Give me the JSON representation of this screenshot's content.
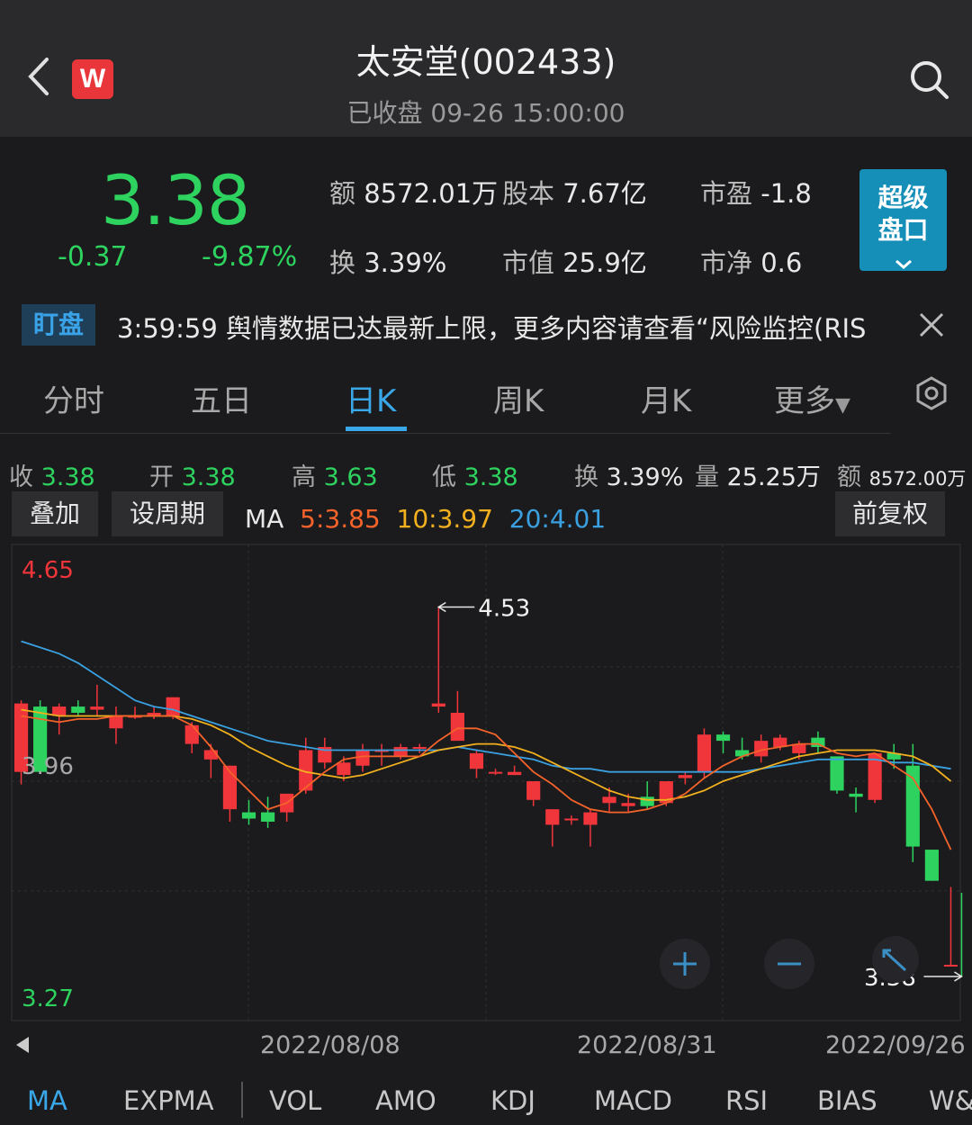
{
  "header": {
    "title": "太安堂(002433)",
    "subtitle": "已收盘 09-26 15:00:00",
    "logo_letter": "W"
  },
  "quote": {
    "price": "3.38",
    "change": "-0.37",
    "change_pct": "-9.87%",
    "amount_label": "额",
    "amount": "8572.01万",
    "share_cap_label": "股本",
    "share_cap": "7.67亿",
    "pe_label": "市盈",
    "pe": "-1.8",
    "turnover_label": "换",
    "turnover": "3.39%",
    "mkt_cap_label": "市值",
    "mkt_cap": "25.9亿",
    "pb_label": "市净",
    "pb": "0.6",
    "super_button": [
      "超级",
      "盘口"
    ],
    "color_down": "#2ed35f",
    "color_up": "#f0353b"
  },
  "ticker": {
    "badge": "盯盘",
    "text": "3:59:59 舆情数据已达最新上限，更多内容请查看“风险监控(RIS"
  },
  "tabs": [
    "分时",
    "五日",
    "日K",
    "周K",
    "月K",
    "更多"
  ],
  "active_tab": "日K",
  "stats": {
    "close_label": "收",
    "close": "3.38",
    "open_label": "开",
    "open": "3.38",
    "high_label": "高",
    "high": "3.63",
    "low_label": "低",
    "low": "3.38",
    "turnover_label": "换",
    "turnover": "3.39%",
    "volume_label": "量",
    "volume": "25.25万",
    "amount_label": "额",
    "amount": "8572.00万"
  },
  "buttons": {
    "overlay": "叠加",
    "period": "设周期",
    "adjust": "前复权"
  },
  "ma_legend": {
    "label": "MA",
    "ma5": "5:3.85",
    "ma10": "10:3.97",
    "ma20": "20:4.01",
    "color_ma5": "#f5632a",
    "color_ma10": "#f2b01e",
    "color_ma20": "#3aa0e0"
  },
  "chart_data": {
    "type": "candlestick",
    "y_axis_labels": [
      "4.65",
      "3.96",
      "3.27"
    ],
    "ylim": [
      3.27,
      4.65
    ],
    "max_marker": "4.53",
    "last_marker": "3.38",
    "x_labels": [
      "2022/08/08",
      "2022/08/31",
      "2022/09/26"
    ],
    "candles": [
      {
        "o": 4.0,
        "h": 4.23,
        "l": 3.96,
        "c": 4.22
      },
      {
        "o": 4.21,
        "h": 4.23,
        "l": 4.0,
        "c": 4.0
      },
      {
        "o": 4.18,
        "h": 4.22,
        "l": 4.12,
        "c": 4.21
      },
      {
        "o": 4.21,
        "h": 4.23,
        "l": 4.18,
        "c": 4.19
      },
      {
        "o": 4.2,
        "h": 4.28,
        "l": 4.18,
        "c": 4.21
      },
      {
        "o": 4.14,
        "h": 4.21,
        "l": 4.09,
        "c": 4.18
      },
      {
        "o": 4.18,
        "h": 4.21,
        "l": 4.17,
        "c": 4.18
      },
      {
        "o": 4.18,
        "h": 4.21,
        "l": 4.17,
        "c": 4.19
      },
      {
        "o": 4.18,
        "h": 4.24,
        "l": 4.17,
        "c": 4.24
      },
      {
        "o": 4.09,
        "h": 4.16,
        "l": 4.06,
        "c": 4.15
      },
      {
        "o": 4.04,
        "h": 4.09,
        "l": 3.98,
        "c": 4.07
      },
      {
        "o": 3.88,
        "h": 4.02,
        "l": 3.84,
        "c": 4.02
      },
      {
        "o": 3.87,
        "h": 3.91,
        "l": 3.83,
        "c": 3.85
      },
      {
        "o": 3.87,
        "h": 3.92,
        "l": 3.82,
        "c": 3.84
      },
      {
        "o": 3.87,
        "h": 3.93,
        "l": 3.84,
        "c": 3.93
      },
      {
        "o": 3.94,
        "h": 4.11,
        "l": 3.93,
        "c": 4.07
      },
      {
        "o": 4.03,
        "h": 4.11,
        "l": 4.01,
        "c": 4.08
      },
      {
        "o": 3.99,
        "h": 4.05,
        "l": 3.97,
        "c": 4.03
      },
      {
        "o": 4.02,
        "h": 4.09,
        "l": 4.0,
        "c": 4.07
      },
      {
        "o": 4.07,
        "h": 4.09,
        "l": 4.02,
        "c": 4.07
      },
      {
        "o": 4.05,
        "h": 4.09,
        "l": 4.04,
        "c": 4.08
      },
      {
        "o": 4.08,
        "h": 4.09,
        "l": 4.06,
        "c": 4.08
      },
      {
        "o": 4.21,
        "h": 4.53,
        "l": 4.19,
        "c": 4.22
      },
      {
        "o": 4.1,
        "h": 4.26,
        "l": 4.1,
        "c": 4.19
      },
      {
        "o": 4.01,
        "h": 4.07,
        "l": 3.98,
        "c": 4.06
      },
      {
        "o": 4.0,
        "h": 4.01,
        "l": 3.99,
        "c": 4.0
      },
      {
        "o": 3.99,
        "h": 4.02,
        "l": 3.99,
        "c": 4.0
      },
      {
        "o": 3.91,
        "h": 3.97,
        "l": 3.89,
        "c": 3.97
      },
      {
        "o": 3.83,
        "h": 3.88,
        "l": 3.76,
        "c": 3.88
      },
      {
        "o": 3.85,
        "h": 3.86,
        "l": 3.83,
        "c": 3.85
      },
      {
        "o": 3.83,
        "h": 3.88,
        "l": 3.76,
        "c": 3.87
      },
      {
        "o": 3.9,
        "h": 3.95,
        "l": 3.87,
        "c": 3.92
      },
      {
        "o": 3.89,
        "h": 3.93,
        "l": 3.87,
        "c": 3.9
      },
      {
        "o": 3.92,
        "h": 3.97,
        "l": 3.88,
        "c": 3.89
      },
      {
        "o": 3.9,
        "h": 3.97,
        "l": 3.89,
        "c": 3.97
      },
      {
        "o": 3.98,
        "h": 4.0,
        "l": 3.96,
        "c": 3.99
      },
      {
        "o": 4.0,
        "h": 4.14,
        "l": 3.98,
        "c": 4.12
      },
      {
        "o": 4.12,
        "h": 4.13,
        "l": 4.06,
        "c": 4.1
      },
      {
        "o": 4.07,
        "h": 4.11,
        "l": 4.04,
        "c": 4.05
      },
      {
        "o": 4.05,
        "h": 4.12,
        "l": 4.03,
        "c": 4.1
      },
      {
        "o": 4.08,
        "h": 4.12,
        "l": 4.07,
        "c": 4.11
      },
      {
        "o": 4.06,
        "h": 4.1,
        "l": 4.04,
        "c": 4.09
      },
      {
        "o": 4.11,
        "h": 4.13,
        "l": 4.06,
        "c": 4.08
      },
      {
        "o": 4.05,
        "h": 4.05,
        "l": 3.93,
        "c": 3.94
      },
      {
        "o": 3.93,
        "h": 3.95,
        "l": 3.87,
        "c": 3.92
      },
      {
        "o": 3.91,
        "h": 4.06,
        "l": 3.9,
        "c": 4.06
      },
      {
        "o": 4.06,
        "h": 4.09,
        "l": 4.01,
        "c": 4.04
      },
      {
        "o": 4.02,
        "h": 4.09,
        "l": 3.71,
        "c": 3.76
      },
      {
        "o": 3.75,
        "h": 3.75,
        "l": 3.65,
        "c": 3.65
      },
      {
        "o": 3.38,
        "h": 3.63,
        "l": 3.38,
        "c": 3.38
      }
    ],
    "ma5": [
      4.18,
      4.17,
      4.16,
      4.17,
      4.17,
      4.18,
      4.18,
      4.18,
      4.18,
      4.15,
      4.08,
      4.0,
      3.94,
      3.88,
      3.9,
      3.95,
      4.0,
      4.04,
      4.05,
      4.05,
      4.05,
      4.05,
      4.1,
      4.14,
      4.14,
      4.12,
      4.06,
      4.0,
      3.96,
      3.91,
      3.88,
      3.87,
      3.87,
      3.88,
      3.9,
      3.93,
      3.98,
      4.02,
      4.05,
      4.07,
      4.08,
      4.09,
      4.09,
      4.06,
      4.05,
      4.06,
      4.02,
      3.98,
      3.88,
      3.75
    ],
    "ma10": [
      4.2,
      4.19,
      4.18,
      4.18,
      4.18,
      4.18,
      4.18,
      4.18,
      4.18,
      4.17,
      4.15,
      4.12,
      4.08,
      4.05,
      4.02,
      4.0,
      3.99,
      3.98,
      3.99,
      4.01,
      4.03,
      4.05,
      4.07,
      4.08,
      4.09,
      4.09,
      4.08,
      4.06,
      4.03,
      4.0,
      3.97,
      3.94,
      3.92,
      3.91,
      3.91,
      3.92,
      3.94,
      3.97,
      3.99,
      4.01,
      4.03,
      4.05,
      4.06,
      4.07,
      4.07,
      4.07,
      4.06,
      4.05,
      4.02,
      3.97
    ],
    "ma20": [
      4.42,
      4.4,
      4.38,
      4.35,
      4.31,
      4.27,
      4.23,
      4.21,
      4.2,
      4.18,
      4.16,
      4.14,
      4.12,
      4.1,
      4.09,
      4.08,
      4.07,
      4.07,
      4.07,
      4.07,
      4.07,
      4.07,
      4.07,
      4.08,
      4.07,
      4.06,
      4.05,
      4.04,
      4.02,
      4.01,
      4.01,
      4.0,
      4.0,
      4.0,
      4.0,
      4.0,
      4.0,
      4.0,
      4.0,
      4.01,
      4.02,
      4.03,
      4.04,
      4.04,
      4.04,
      4.04,
      4.03,
      4.03,
      4.02,
      4.01
    ]
  },
  "indicators": [
    "MA",
    "EXPMA",
    "VOL",
    "AMO",
    "KDJ",
    "MACD",
    "RSI",
    "BIAS",
    "W&"
  ],
  "active_indicator": "MA"
}
